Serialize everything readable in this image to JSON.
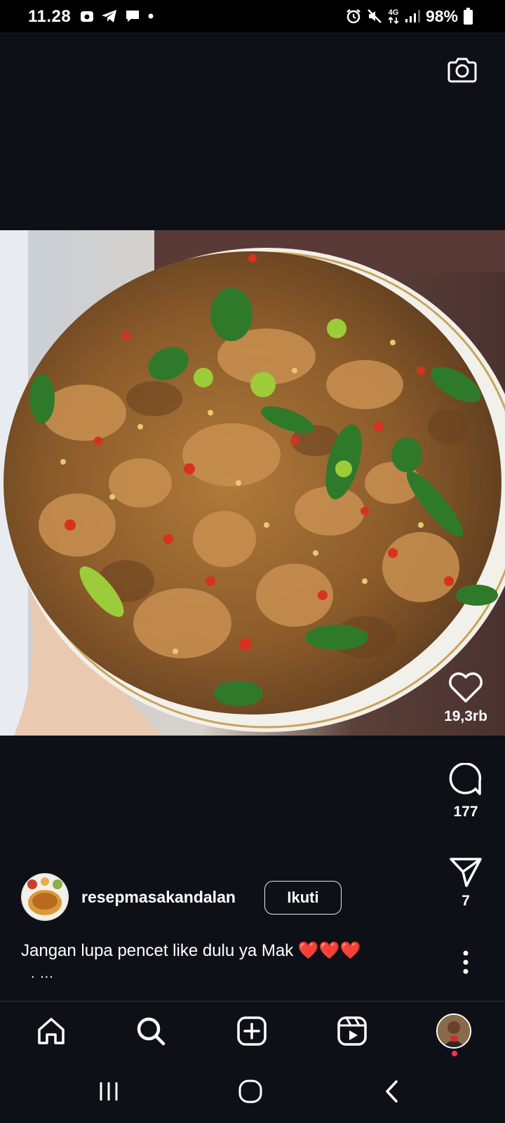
{
  "status_bar": {
    "time": "11.28",
    "network": "4G",
    "battery": "98%",
    "left_icons": [
      "gallery-notification-icon",
      "telegram-icon",
      "chat-icon",
      "dot-icon"
    ],
    "right_icons": [
      "alarm-icon",
      "mute-icon",
      "network-4g-icon",
      "signal-icon",
      "battery-icon"
    ]
  },
  "header": {
    "camera_icon": "camera-icon"
  },
  "post": {
    "author": "resepmasakandalan",
    "follow_label": "Ikuti",
    "caption": "Jangan lupa pencet like dulu ya Mak ❤️❤️❤️",
    "caption_more": ". ...",
    "likes": "19,3rb",
    "comments": "177",
    "shares": "7"
  },
  "bottom_nav": {
    "items": [
      "home-icon",
      "search-icon",
      "create-icon",
      "reels-icon",
      "profile"
    ]
  },
  "system_nav": [
    "recent-apps-icon",
    "home-circle-icon",
    "back-icon"
  ],
  "colors": {
    "background": "#0d1117",
    "text": "#ffffff",
    "notification_dot": "#ff2e4d"
  }
}
